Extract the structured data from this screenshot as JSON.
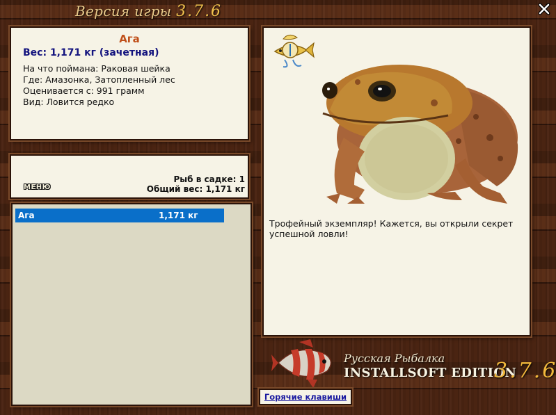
{
  "window": {
    "title_prefix": "Версия игры",
    "title_version": "3.7.6"
  },
  "fish": {
    "name": "Ага",
    "weight": "Вес: 1,171 кг (зачетная)",
    "lines": [
      "На что поймана: Раковая шейка",
      "Где: Амазонка, Затопленный лес",
      "Оценивается с: 991 грамм",
      "Вид: Ловится редко"
    ]
  },
  "catch": {
    "menu_label": "МЕНЮ",
    "count_text": "Рыб в садке: 1",
    "total_text": "Общий вес: 1,171 кг"
  },
  "list": {
    "rows": [
      {
        "name": "Ага",
        "weight": "1,171 кг",
        "selected": true
      }
    ]
  },
  "detail": {
    "message": "Трофейный экземпляр! Кажется, вы открыли секрет успешной ловли!"
  },
  "logo": {
    "subtitle": "Русская Рыбалка",
    "edition": "INSTALLSOFT EDITION",
    "version": "3.7.6"
  },
  "footer": {
    "hotkeys_label": "Горячие клавиши"
  },
  "colors": {
    "selection": "#0a6fc9",
    "fish_name": "#c0501a",
    "weight_text": "#13137e"
  }
}
